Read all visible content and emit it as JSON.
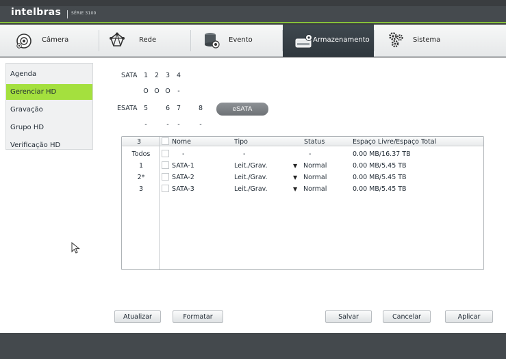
{
  "brand": {
    "name": "intelbras",
    "series": "SÉRIE 3100"
  },
  "tabs": [
    {
      "label": "Câmera",
      "icon": "camera-icon"
    },
    {
      "label": "Rede",
      "icon": "network-icon"
    },
    {
      "label": "Evento",
      "icon": "event-icon"
    },
    {
      "label": "Armazenamento",
      "icon": "storage-icon"
    },
    {
      "label": "Sistema",
      "icon": "system-gears-icon"
    }
  ],
  "sidebar": {
    "items": [
      {
        "label": "Agenda"
      },
      {
        "label": "Gerenciar HD"
      },
      {
        "label": "Gravação"
      },
      {
        "label": "Grupo HD"
      },
      {
        "label": "Verificação HD"
      }
    ]
  },
  "sata": {
    "label": "SATA",
    "ports": [
      "1",
      "2",
      "3",
      "4"
    ],
    "status": [
      "O",
      "O",
      "O",
      "-"
    ]
  },
  "esata": {
    "label": "ESATA",
    "ports": [
      "5",
      "6",
      "7",
      "8"
    ],
    "status": [
      "-",
      "-",
      "-",
      "-"
    ],
    "button": "eSATA"
  },
  "table": {
    "count": "3",
    "headers": {
      "nome": "Nome",
      "tipo": "Tipo",
      "status": "Status",
      "espaco": "Espaço Livre/Espaço Total"
    },
    "rows": [
      {
        "idx": "Todos",
        "nome": "-",
        "tipo": "-",
        "status": "-",
        "espaco": "0.00 MB/16.37 TB",
        "dropdown": false
      },
      {
        "idx": "1",
        "nome": "SATA-1",
        "tipo": "Leit./Grav.",
        "status": "Normal",
        "espaco": "0.00 MB/5.45 TB",
        "dropdown": true
      },
      {
        "idx": "2*",
        "nome": "SATA-2",
        "tipo": "Leit./Grav.",
        "status": "Normal",
        "espaco": "0.00 MB/5.45 TB",
        "dropdown": true
      },
      {
        "idx": "3",
        "nome": "SATA-3",
        "tipo": "Leit./Grav.",
        "status": "Normal",
        "espaco": "0.00 MB/5.45 TB",
        "dropdown": true
      }
    ]
  },
  "footer": {
    "atualizar": "Atualizar",
    "formatar": "Formatar",
    "salvar": "Salvar",
    "cancelar": "Cancelar",
    "aplicar": "Aplicar"
  },
  "colors": {
    "accent": "#a4e03e",
    "titlebar": "#454a4e",
    "active_tab": "#3a434a"
  }
}
